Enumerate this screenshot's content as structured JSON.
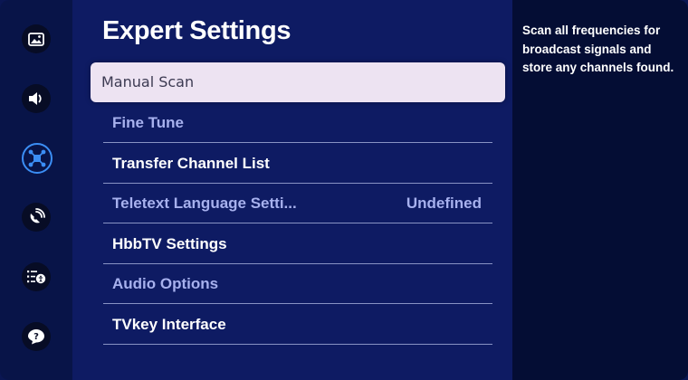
{
  "rail": {
    "icons": [
      {
        "name": "picture-icon"
      },
      {
        "name": "sound-icon"
      },
      {
        "name": "connection-icon",
        "selected": true
      },
      {
        "name": "broadcast-icon"
      },
      {
        "name": "general-accessibility-icon"
      },
      {
        "name": "support-icon"
      }
    ],
    "accent_color": "#3b8ef5"
  },
  "main": {
    "title": "Expert Settings",
    "items": [
      {
        "label": "Manual Scan",
        "focused": true
      },
      {
        "label": "Fine Tune",
        "enabled": false
      },
      {
        "label": "Transfer Channel List",
        "enabled": true
      },
      {
        "label": "Teletext Language Setti...",
        "value": "Undefined",
        "enabled": false
      },
      {
        "label": "HbbTV Settings",
        "enabled": true
      },
      {
        "label": "Audio Options",
        "enabled": false
      },
      {
        "label": "TVkey Interface",
        "enabled": true
      }
    ]
  },
  "description": {
    "text": "Scan all frequencies for broadcast signals and store any channels found."
  },
  "colors": {
    "background": "#0e1b63",
    "focus_background": "#ede3f2",
    "disabled_text": "#a7b1ee"
  }
}
